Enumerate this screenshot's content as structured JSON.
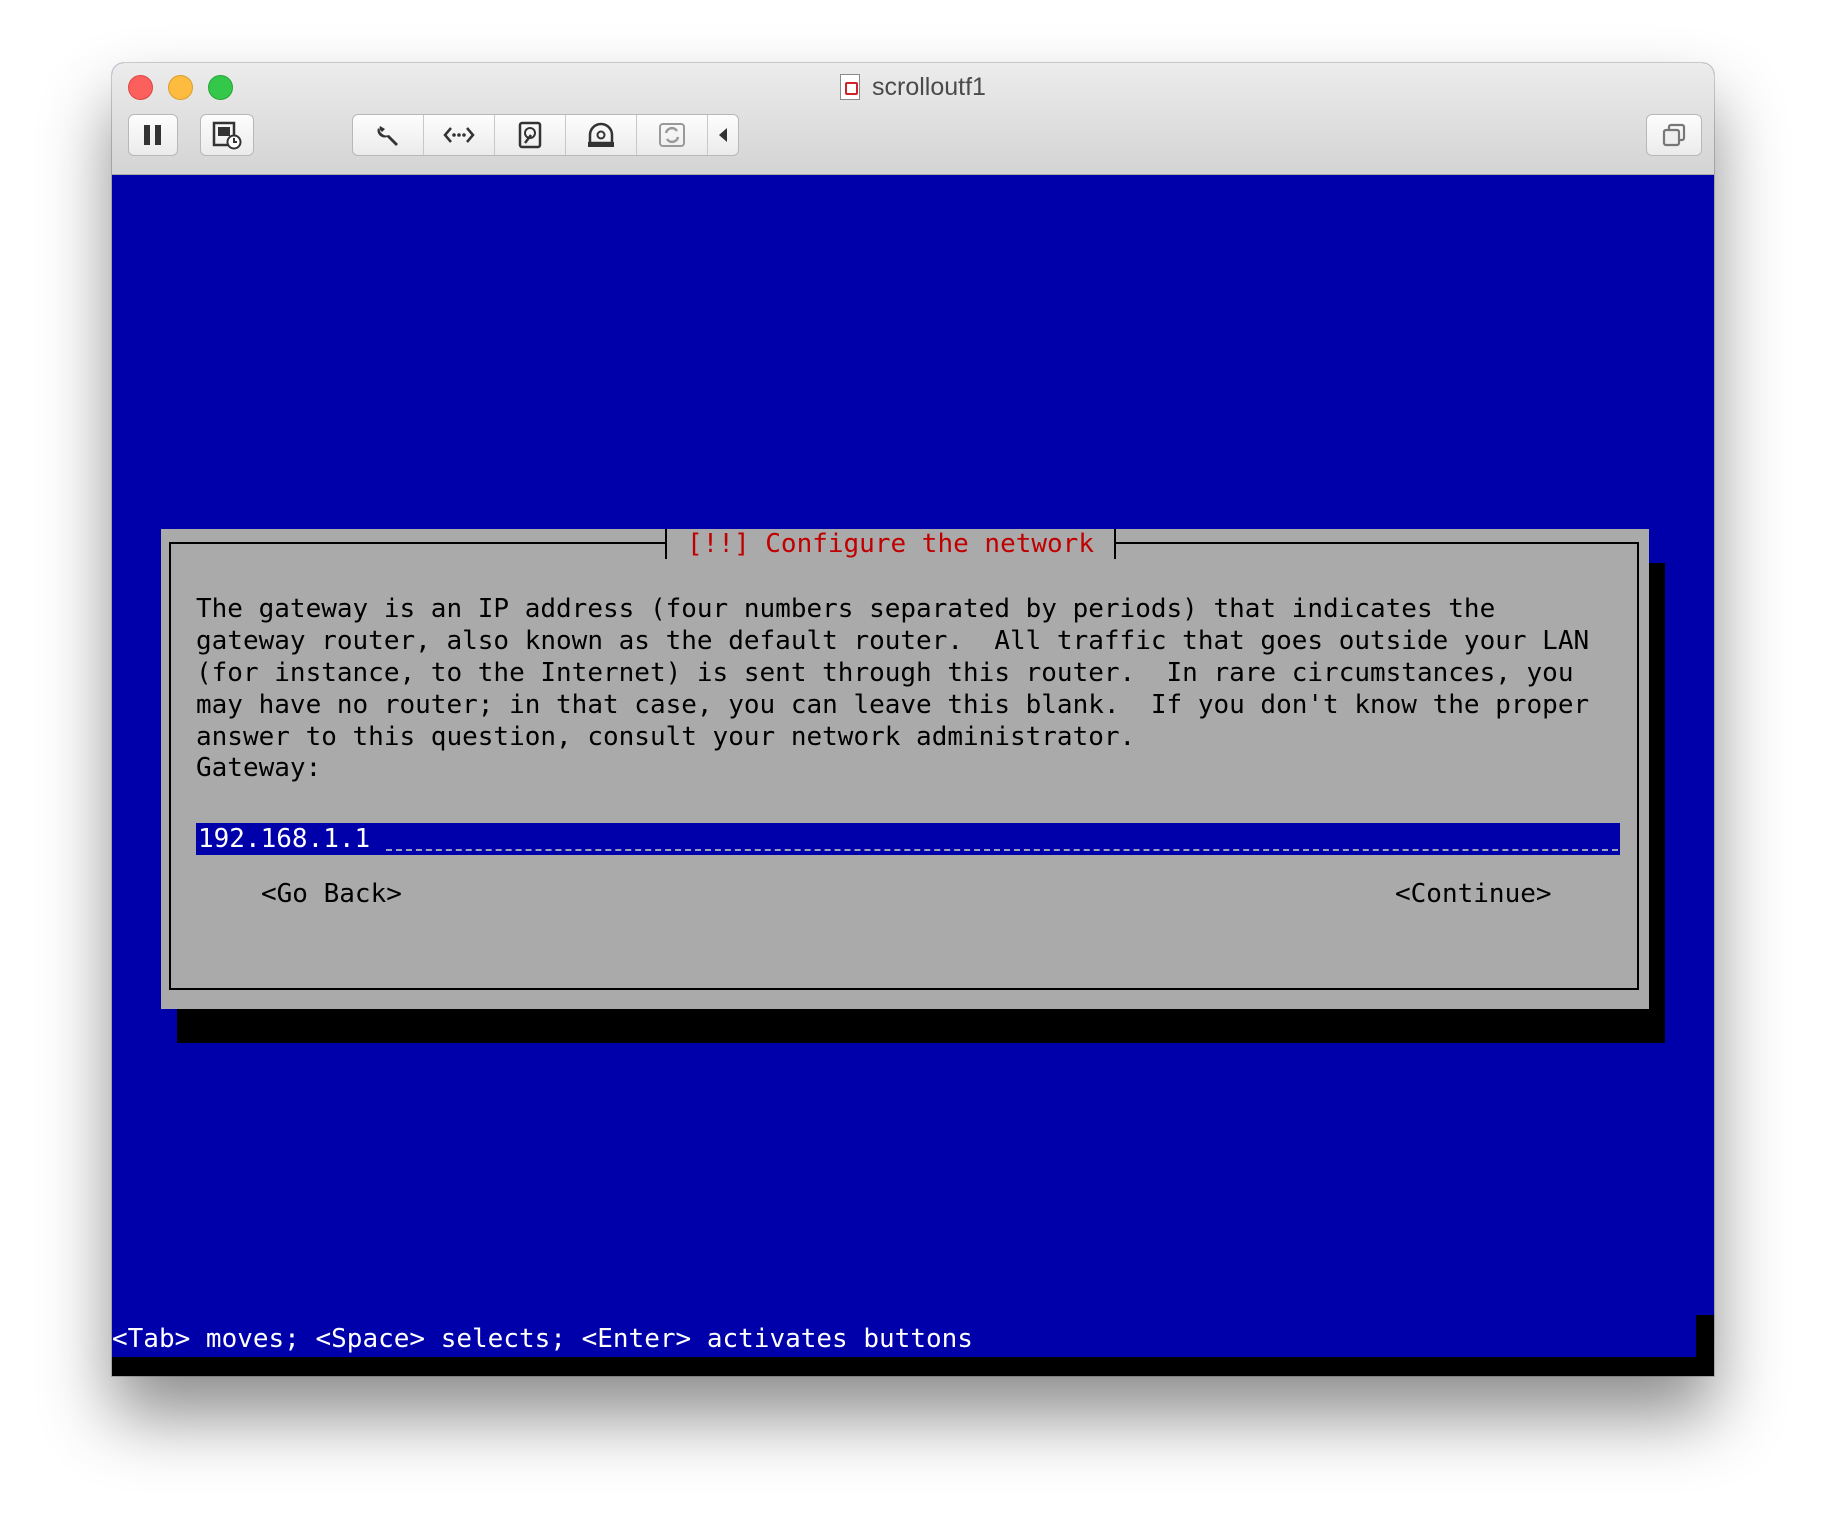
{
  "window": {
    "title": "scrolloutf1"
  },
  "toolbar": {
    "buttons": [
      {
        "name": "pause",
        "icon": "pause-icon"
      },
      {
        "name": "snapshot",
        "icon": "snapshot-icon"
      },
      {
        "name": "settings",
        "icon": "wrench-icon"
      },
      {
        "name": "network",
        "icon": "network-arrows-icon"
      },
      {
        "name": "hard-disk",
        "icon": "hard-disk-icon"
      },
      {
        "name": "cd-dvd",
        "icon": "optical-drive-icon"
      },
      {
        "name": "shared-folders",
        "icon": "sync-icon"
      },
      {
        "name": "collapse",
        "icon": "triangle-left-icon"
      },
      {
        "name": "fullscreen",
        "icon": "window-restore-icon"
      }
    ]
  },
  "dialog": {
    "title": "[!!] Configure the network",
    "body": "The gateway is an IP address (four numbers separated by periods) that indicates the\ngateway router, also known as the default router.  All traffic that goes outside your LAN\n(for instance, to the Internet) is sent through this router.  In rare circumstances, you\nmay have no router; in that case, you can leave this blank.  If you don't know the proper\nanswer to this question, consult your network administrator.",
    "field_label": "Gateway:",
    "field_value": "192.168.1.1",
    "back_button": "<Go Back>",
    "continue_button": "<Continue>"
  },
  "status": {
    "text": "<Tab> moves; <Space> selects; <Enter> activates buttons"
  },
  "colors": {
    "screen_bg": "#0000aa",
    "dialog_bg": "#aaaaaa",
    "dialog_title": "#c00000",
    "shadow": "#000000"
  }
}
